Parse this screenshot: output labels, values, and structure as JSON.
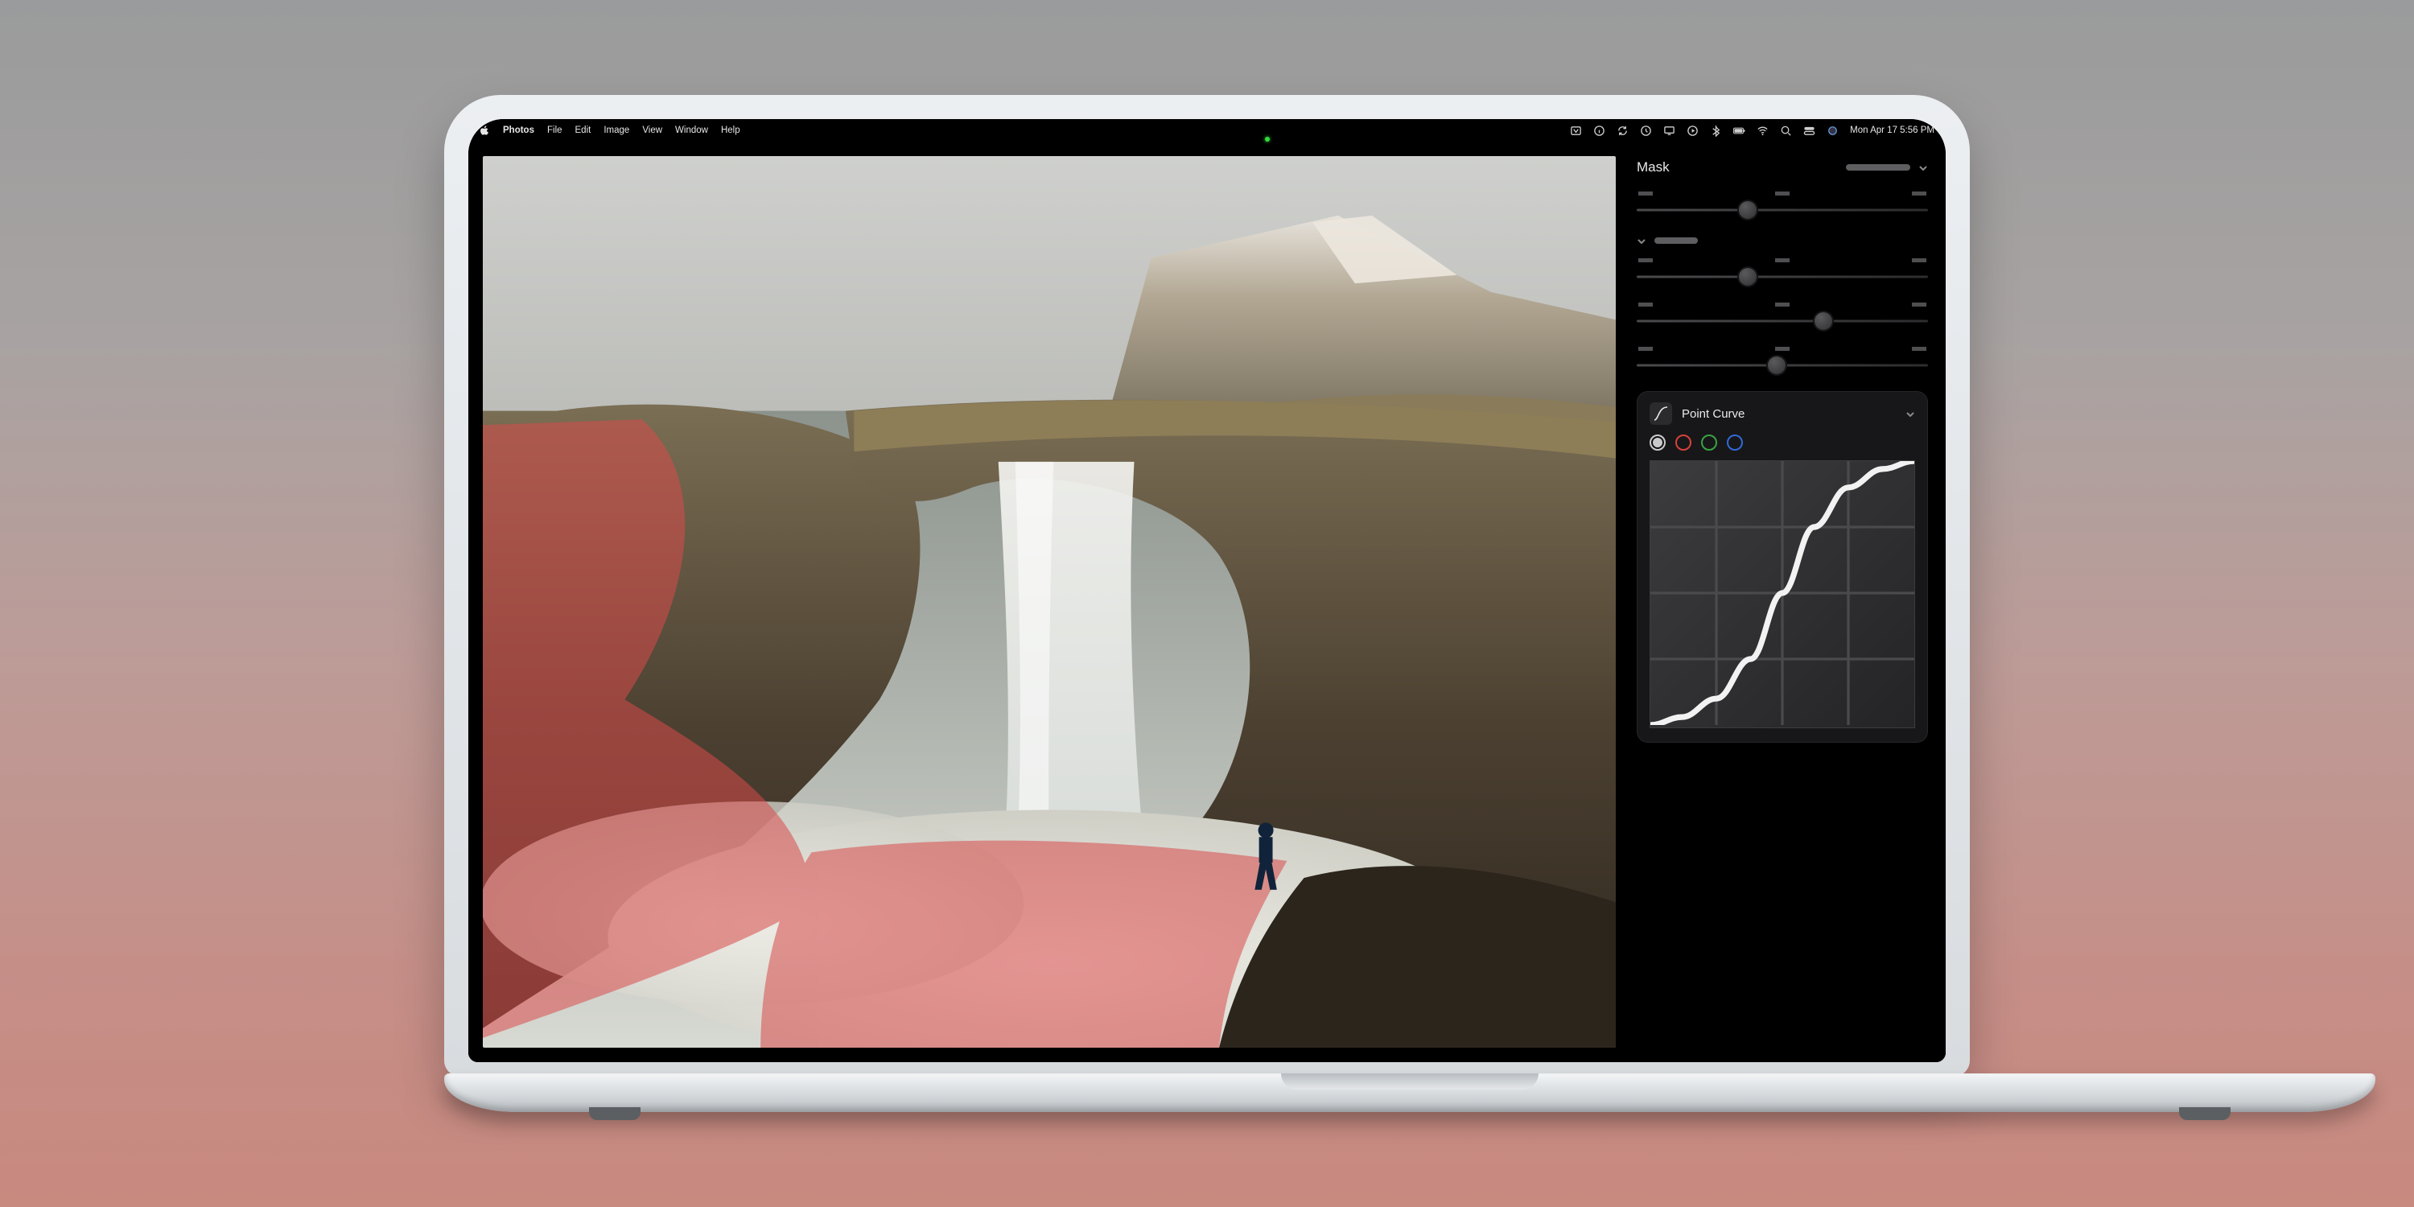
{
  "menubar": {
    "app": "Photos",
    "items": [
      "File",
      "Edit",
      "Image",
      "View",
      "Window",
      "Help"
    ],
    "clock": "Mon Apr 17  5:56 PM"
  },
  "sidebar": {
    "mask": {
      "title": "Mask",
      "sliders": [
        {
          "value": 38
        }
      ],
      "group2_sliders": [
        {
          "value": 38
        },
        {
          "value": 64
        },
        {
          "value": 48
        }
      ]
    },
    "curve": {
      "title": "Point Curve",
      "channels": [
        "luma",
        "red",
        "green",
        "blue"
      ],
      "active_channel": "luma"
    }
  },
  "chart_data": {
    "type": "line",
    "title": "Point Curve",
    "xlabel": "",
    "ylabel": "",
    "xlim": [
      0,
      100
    ],
    "ylim": [
      0,
      100
    ],
    "x": [
      0,
      12,
      25,
      38,
      50,
      62,
      75,
      88,
      100
    ],
    "values": [
      0,
      3,
      10,
      25,
      50,
      75,
      90,
      97,
      100
    ]
  }
}
